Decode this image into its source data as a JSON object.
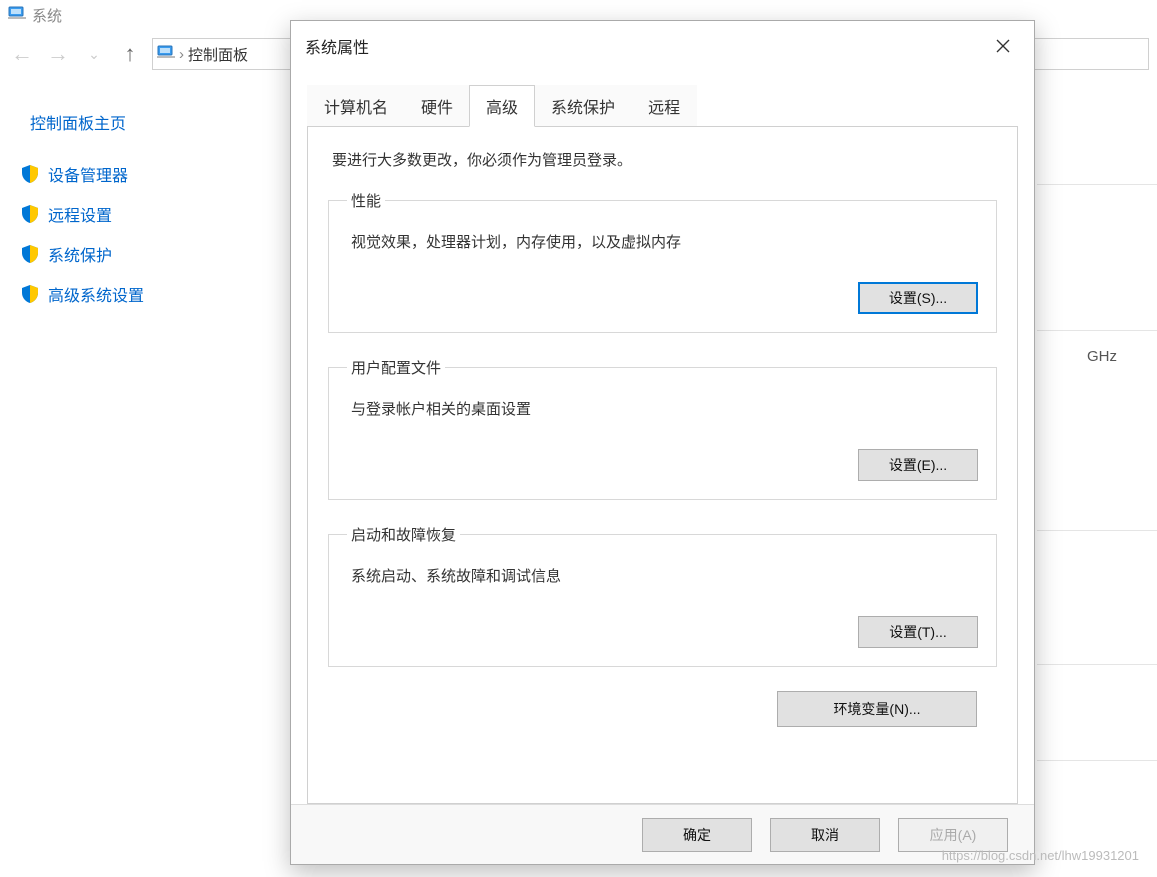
{
  "bg": {
    "title": "系统",
    "breadcrumb": "控制面板",
    "sidebar": {
      "home": "控制面板主页",
      "items": [
        "设备管理器",
        "远程设置",
        "系统保护",
        "高级系统设置"
      ]
    },
    "partial_text": "GHz"
  },
  "dialog": {
    "title": "系统属性",
    "tabs": [
      "计算机名",
      "硬件",
      "高级",
      "系统保护",
      "远程"
    ],
    "active_tab": "高级",
    "note": "要进行大多数更改，你必须作为管理员登录。",
    "performance": {
      "legend": "性能",
      "desc": "视觉效果，处理器计划，内存使用，以及虚拟内存",
      "button": "设置(S)..."
    },
    "profiles": {
      "legend": "用户配置文件",
      "desc": "与登录帐户相关的桌面设置",
      "button": "设置(E)..."
    },
    "startup": {
      "legend": "启动和故障恢复",
      "desc": "系统启动、系统故障和调试信息",
      "button": "设置(T)..."
    },
    "env_button": "环境变量(N)...",
    "buttons": {
      "ok": "确定",
      "cancel": "取消",
      "apply": "应用(A)"
    }
  },
  "watermark": "https://blog.csdn.net/lhw19931201"
}
